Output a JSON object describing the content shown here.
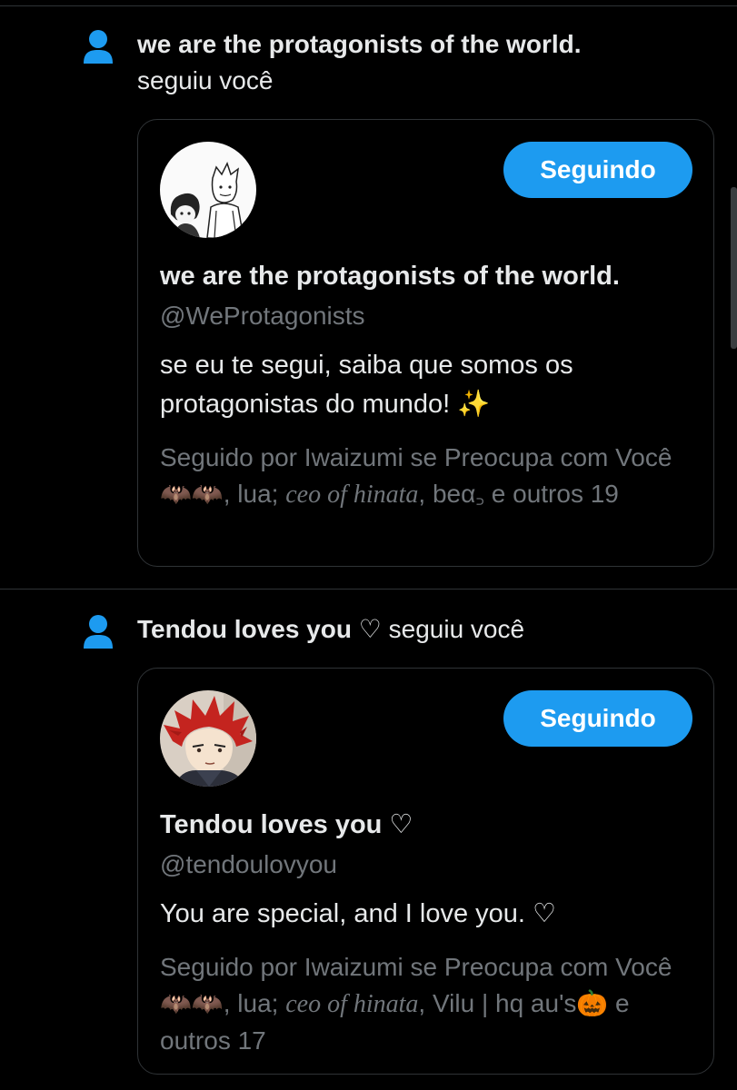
{
  "notifications": [
    {
      "name": "we are the protagonists of the world.",
      "action": "seguiu você",
      "button_label": "Seguindo",
      "display_name": "we are the protagonists of the world.",
      "handle": "@WeProtagonists",
      "bio": "se eu te segui, saiba que somos os protagonistas do mundo!",
      "bio_emoji": "✨",
      "followed_by_prefix": "Seguido por Iwaizumi se Preocupa com Você🦇🦇, lua; ",
      "followed_by_italic": "ceo of hinata",
      "followed_by_suffix": ", beα꜆ e outros 19"
    },
    {
      "name": "Tendou loves you ♡",
      "action": "seguiu você",
      "button_label": "Seguindo",
      "display_name": "Tendou loves you ♡",
      "handle": "@tendoulovyou",
      "bio": "You are special, and I love you. ♡",
      "followed_by_prefix": "Seguido por Iwaizumi se Preocupa com Você🦇🦇, lua; ",
      "followed_by_italic": "ceo of hinata",
      "followed_by_suffix": ", Vilu | hq au's🎃 e outros 17"
    }
  ],
  "colors": {
    "background": "#000000",
    "accent": "#1d9bf0",
    "text_primary": "#e7e9ea",
    "text_secondary": "#71767b",
    "border": "#2f3336"
  },
  "icons": {
    "notification_type": "person-icon"
  }
}
